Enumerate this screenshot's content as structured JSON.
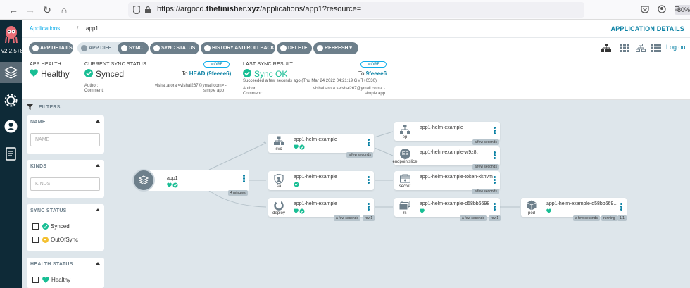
{
  "browser": {
    "url_prefix": "https://argocd.",
    "url_domain": "thefinisher.xyz",
    "url_suffix": "/applications/app1?resource=",
    "zoom": "80%"
  },
  "sidebar": {
    "version": "v2.2.5+8"
  },
  "breadcrumb": {
    "root": "Applications",
    "sep": "/",
    "current": "app1"
  },
  "header": {
    "app_details": "APPLICATION DETAILS",
    "logout": "Log out"
  },
  "toolbar": {
    "app_details": "APP DETAILS",
    "app_diff": "APP DIFF",
    "sync": "SYNC",
    "sync_status": "SYNC STATUS",
    "history": "HISTORY AND ROLLBACK",
    "delete": "DELETE",
    "refresh": "REFRESH"
  },
  "status": {
    "health_label": "APP HEALTH",
    "health_value": "Healthy",
    "sync_label": "CURRENT SYNC STATUS",
    "sync_value": "Synced",
    "sync_more": "MORE",
    "sync_to": "To",
    "sync_rev": "HEAD (9feeee6)",
    "author_label": "Author:",
    "comment_label": "Comment:",
    "author_value": "vishal.arora <vishal267@ymail.com> -",
    "comment_value": "simple app",
    "last_label": "LAST SYNC RESULT",
    "last_value": "Sync OK",
    "last_more": "MORE",
    "last_to": "To",
    "last_rev": "9feeee6",
    "last_time": "Succeeded a few seconds ago (Thu Mar 24 2022 04:21:19 GMT+0530)",
    "last_author_value": "vishal.arora <vishal267@ymail.com> -",
    "last_comment_value": "simple app"
  },
  "filters": {
    "title": "FILTERS",
    "name_title": "NAME",
    "name_placeholder": "NAME",
    "kinds_title": "KINDS",
    "kinds_placeholder": "KINDS",
    "sync_title": "SYNC STATUS",
    "sync_opts": [
      "Synced",
      "OutOfSync"
    ],
    "health_title": "HEALTH STATUS",
    "health_opts": [
      "Healthy"
    ]
  },
  "tree": {
    "app": {
      "name": "app1",
      "age": "4 minutes"
    },
    "svc": {
      "name": "app1-helm-example",
      "kind": "svc",
      "age": "a few seconds"
    },
    "sa": {
      "name": "app1-helm-example",
      "kind": "sa"
    },
    "deploy": {
      "name": "app1-helm-example",
      "kind": "deploy",
      "age": "a few seconds",
      "rev": "rev:1"
    },
    "ep": {
      "name": "app1-helm-example",
      "kind": "ep",
      "age": "a few seconds"
    },
    "eps": {
      "name": "app1-helm-example-w9z8t",
      "kind": "endpointslice",
      "badge": "ES",
      "age": "a few seconds"
    },
    "secret": {
      "name": "app1-helm-example-token-xkhvm",
      "kind": "secret",
      "age": "a few seconds"
    },
    "rs": {
      "name": "app1-helm-example-d58bb6698",
      "kind": "rs",
      "age": "a few seconds",
      "rev": "rev:1"
    },
    "pod": {
      "name": "app1-helm-example-d58bb669...",
      "kind": "pod",
      "age": "a few seconds",
      "state": "running",
      "count": "1/1"
    }
  },
  "colors": {
    "healthy": "#18be94",
    "sidebar": "#0e2a37",
    "accent": "#0dadea",
    "outofsync": "#f4c030"
  }
}
